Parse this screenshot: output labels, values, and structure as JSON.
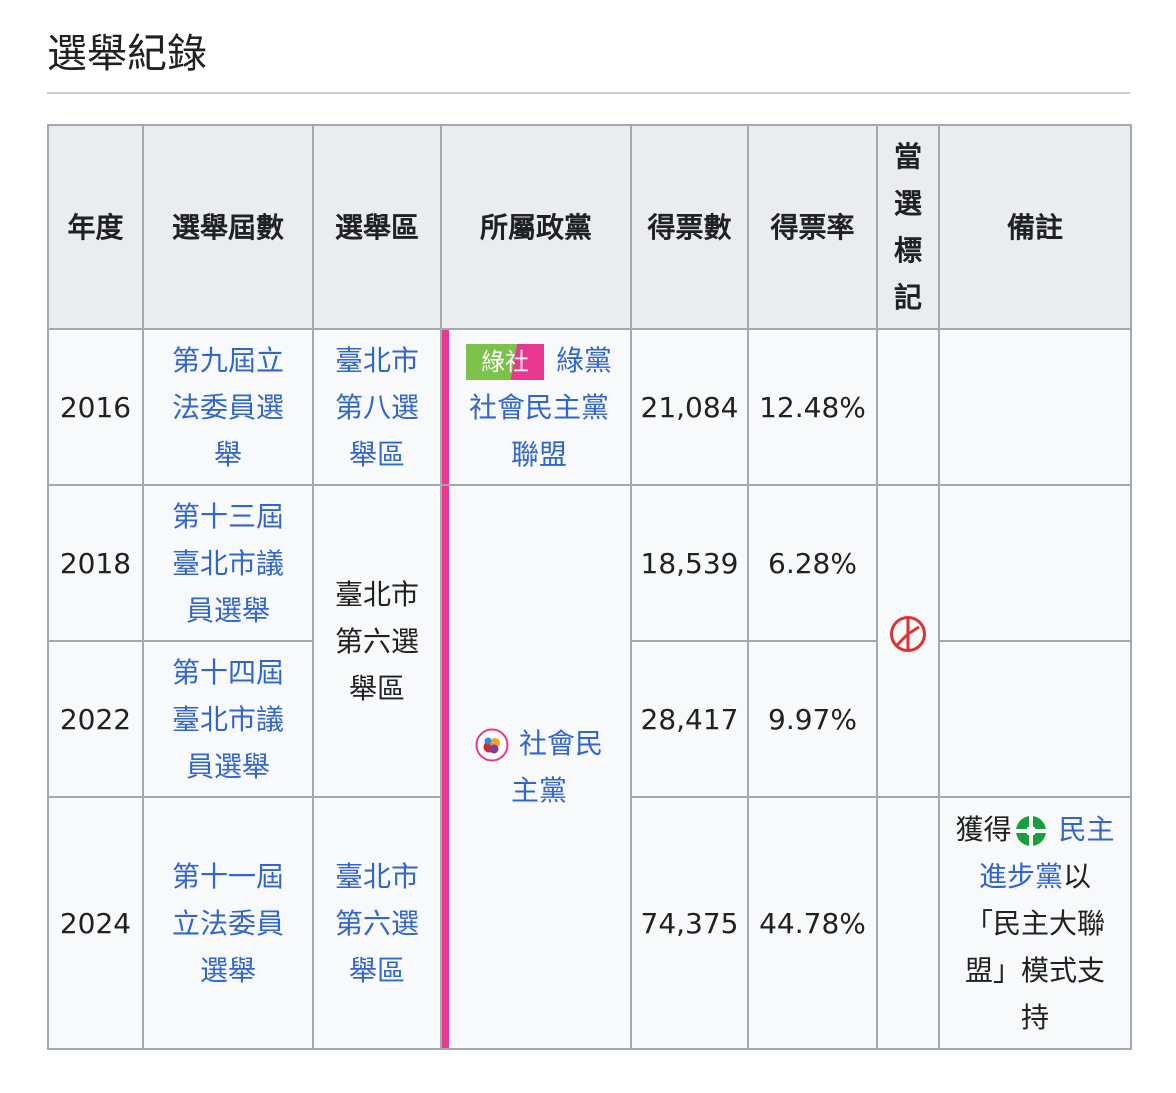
{
  "section": {
    "title": "選舉紀錄"
  },
  "table": {
    "headers": [
      "年度",
      "選舉屆數",
      "選舉區",
      "所屬政黨",
      "得票數",
      "得票率",
      "當選標記",
      "備註"
    ],
    "header_elected_chars": [
      "當",
      "選",
      "標",
      "記"
    ],
    "rows": [
      {
        "year": "2016",
        "election_lines": [
          "第九屆立",
          "法委員選",
          "舉"
        ],
        "district_lines": [
          "臺北市",
          "第八選",
          "舉區"
        ],
        "party_badge": "綠社",
        "party_lines": [
          "綠黨",
          "社會民主黨",
          "聯盟"
        ],
        "votes": "21,084",
        "rate": "12.48%"
      },
      {
        "year": "2018",
        "election_lines": [
          "第十三屆",
          "臺北市議",
          "員選舉"
        ],
        "votes": "18,539",
        "rate": "6.28%"
      },
      {
        "year": "2022",
        "election_lines": [
          "第十四屆",
          "臺北市議",
          "員選舉"
        ],
        "votes": "28,417",
        "rate": "9.97%"
      },
      {
        "year": "2024",
        "election_lines": [
          "第十一屆",
          "立法委員",
          "選舉"
        ],
        "district_lines": [
          "臺北市",
          "第六選",
          "舉區"
        ],
        "votes": "74,375",
        "rate": "44.78%"
      }
    ],
    "shared_district_lines": [
      "臺北市",
      "第六選",
      "舉區"
    ],
    "shared_party_lines": [
      "社會民",
      "主黨"
    ],
    "note_2024": {
      "prefix": "獲得",
      "link_lines": [
        "民主",
        "進步黨"
      ],
      "suffix_lines": [
        "以",
        "「民主大聯",
        "盟」模式支",
        "持"
      ]
    }
  },
  "colors": {
    "link": "#3366cc",
    "header_bg": "#eaecf0",
    "cell_bg": "#f8f9fa",
    "border": "#a2a9b1",
    "party_stripe": "#e8388f",
    "green_party": "#7cc24a",
    "elected_mark": "#d33"
  },
  "icons": {
    "elected": "elected-stamp-icon",
    "sdp": "sdp-logo-icon",
    "dpp": "dpp-logo-icon"
  }
}
